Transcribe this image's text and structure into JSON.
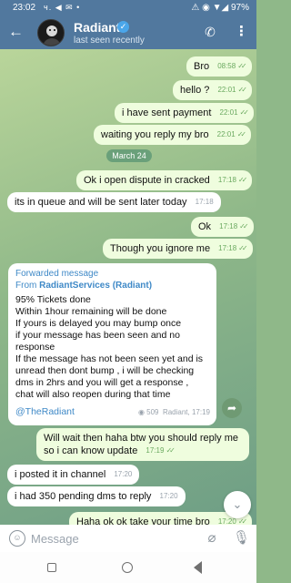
{
  "status_bar": {
    "time": "23:02",
    "left_icons": "ч. ◀ ✉ •",
    "right": "⚠ ◉ ▼◢ 97%"
  },
  "header": {
    "back_icon": "arrow-left-icon",
    "name": "Radiant",
    "verified_glyph": "✓",
    "subtitle": "last seen recently",
    "call_icon": "phone-icon",
    "menu_glyph": "⋮"
  },
  "messages_top": [
    {
      "text": "Bro",
      "time": "08:58"
    },
    {
      "text": "hello ?",
      "time": "22:01"
    },
    {
      "text": "i have sent payment",
      "time": "22:01"
    },
    {
      "text": "waiting you reply my bro",
      "time": "22:01"
    }
  ],
  "date_divider": "March 24",
  "messages_mid": [
    {
      "dir": "out",
      "text": "Ok i open dispute in cracked",
      "time": "17:18"
    },
    {
      "dir": "in",
      "text": "its in queue and will be sent later today",
      "time": "17:18"
    },
    {
      "dir": "out",
      "text": "Ok",
      "time": "17:18"
    },
    {
      "dir": "out",
      "text": "Though you ignore me",
      "time": "17:18"
    }
  ],
  "forwarded": {
    "title": "Forwarded message",
    "from_prefix": "From ",
    "from_name": "RadiantServices (Radiant)",
    "body": "95% Tickets done\nWithin 1hour remaining will be done\nIf yours is delayed you may bump once\nif your message has been seen and no response\nIf the message has not been seen yet and is unread then dont bump , i will be checking dms in 2hrs and you will get a response ,\nchat will also reopen during that time",
    "link": "@TheRadiant",
    "views": "509",
    "author_time": "Radiant, 17:19"
  },
  "messages_bottom": [
    {
      "dir": "out",
      "text": "Will wait then haha btw you should reply me so i can know update",
      "time": "17:19"
    },
    {
      "dir": "in",
      "text": "i posted it in channel",
      "time": "17:20"
    },
    {
      "dir": "in",
      "text": "i had 350 pending dms to reply",
      "time": "17:20"
    },
    {
      "dir": "out",
      "text": "Haha ok ok take your time bro",
      "time": "17:20"
    }
  ],
  "composer": {
    "placeholder": "Message",
    "emoji_icon": "smiley-icon",
    "attach_icon": "paperclip-icon",
    "mic_icon": "microphone-icon"
  },
  "colors": {
    "header_bg": "#51789e",
    "outgoing_bubble": "#effdde",
    "incoming_bubble": "#ffffff",
    "link": "#3f89c7",
    "check_green": "#6aa95f"
  }
}
